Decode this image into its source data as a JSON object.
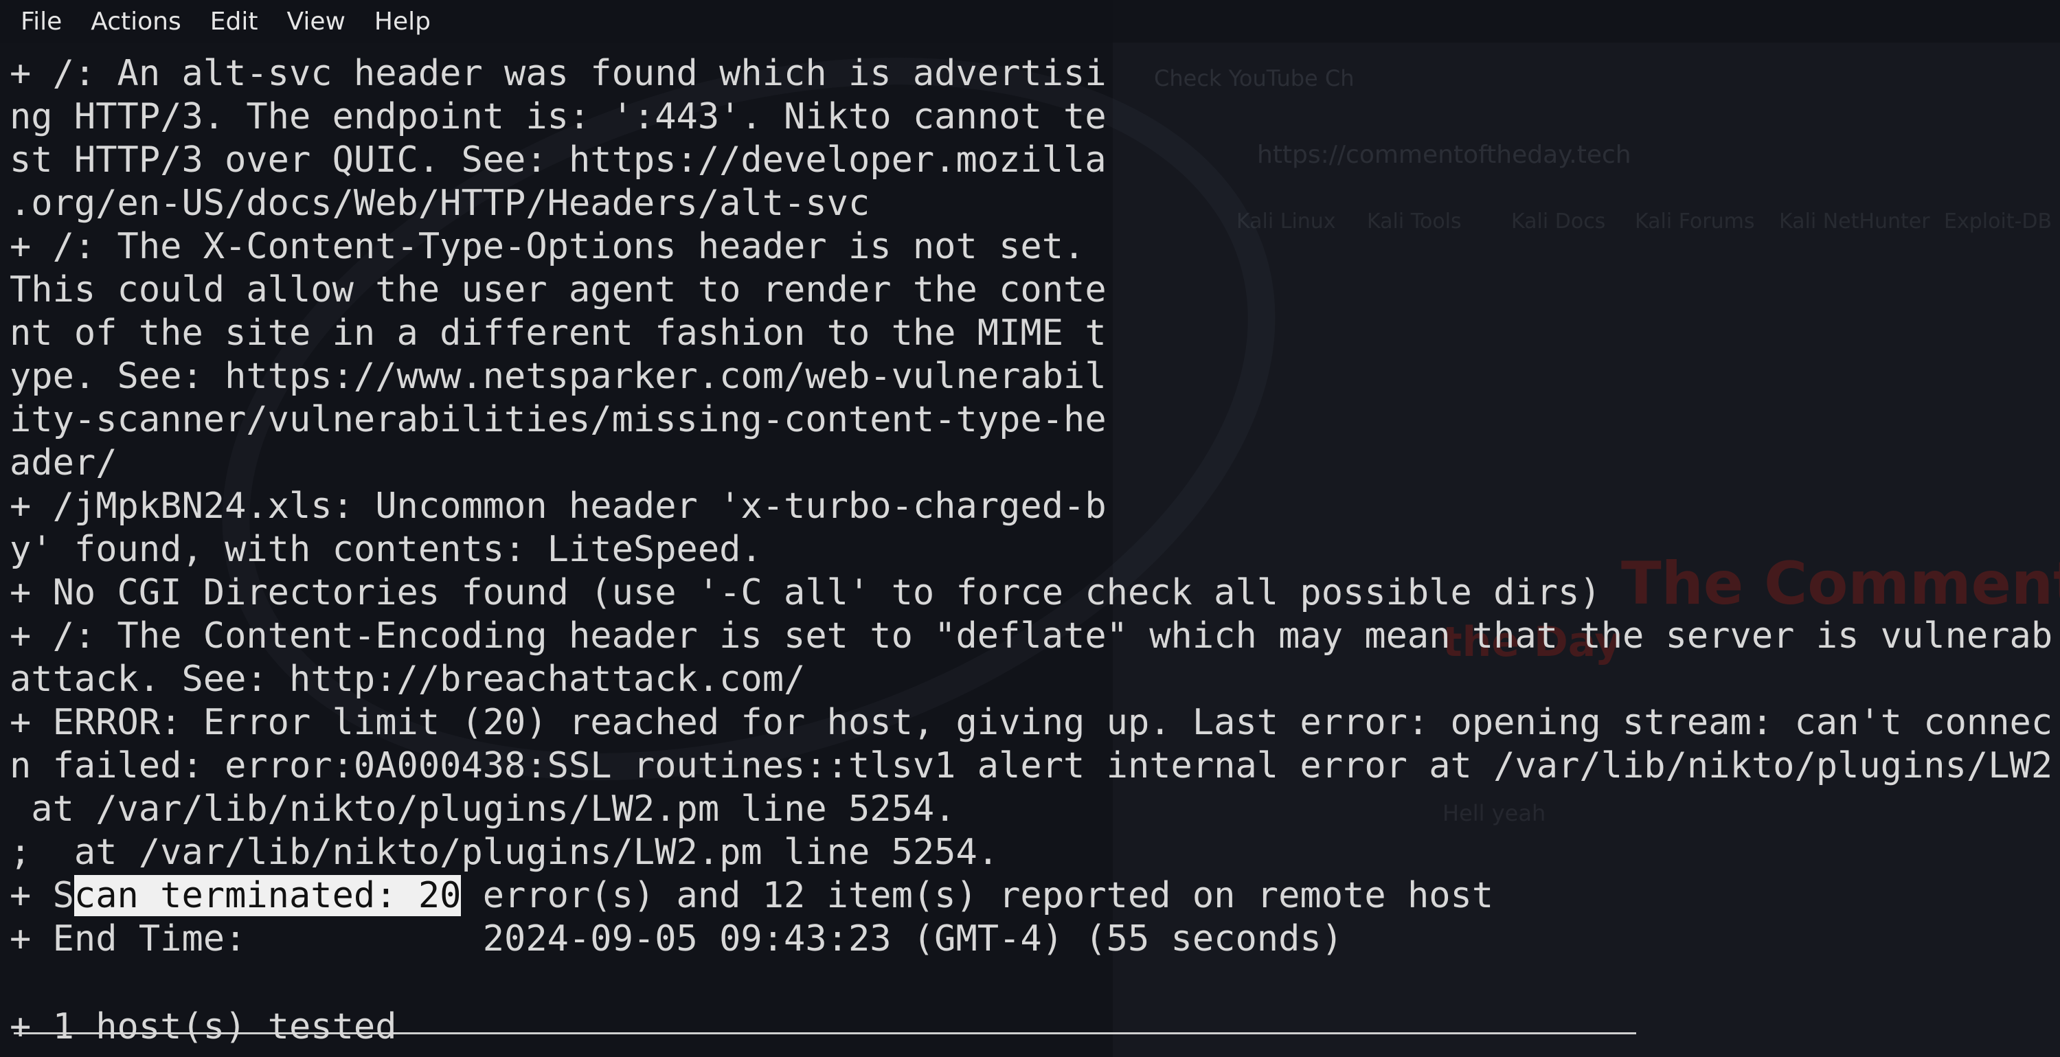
{
  "menu": {
    "items": [
      "File",
      "Actions",
      "Edit",
      "View",
      "Help"
    ]
  },
  "background_browser": {
    "tab_title": "Check YouTube Ch",
    "url": "https://commentoftheday.tech",
    "bookmarks": [
      "Kali Linux",
      "Kali Tools",
      "Kali Docs",
      "Kali Forums",
      "Kali NetHunter",
      "Exploit-DB"
    ],
    "headline": "The Comment of",
    "subheadline": "the Day",
    "caption": "Hell yeah"
  },
  "terminal": {
    "lines": [
      "+ /: An alt-svc header was found which is advertisi",
      "ng HTTP/3. The endpoint is: ':443'. Nikto cannot te",
      "st HTTP/3 over QUIC. See: https://developer.mozilla",
      ".org/en-US/docs/Web/HTTP/Headers/alt-svc",
      "+ /: The X-Content-Type-Options header is not set.",
      "This could allow the user agent to render the conte",
      "nt of the site in a different fashion to the MIME t",
      "ype. See: https://www.netsparker.com/web-vulnerabil",
      "ity-scanner/vulnerabilities/missing-content-type-he",
      "ader/",
      "+ /jMpkBN24.xls: Uncommon header 'x-turbo-charged-b",
      "y' found, with contents: LiteSpeed.",
      "+ No CGI Directories found (use '-C all' to force check all possible dirs)",
      "+ /: The Content-Encoding header is set to \"deflate\" which may mean that the server is vulnerab",
      "attack. See: http://breachattack.com/",
      "+ ERROR: Error limit (20) reached for host, giving up. Last error: opening stream: can't connec",
      "n failed: error:0A000438:SSL routines::tlsv1 alert internal error at /var/lib/nikto/plugins/LW2",
      " at /var/lib/nikto/plugins/LW2.pm line 5254.",
      ";  at /var/lib/nikto/plugins/LW2.pm line 5254."
    ],
    "scan_line": {
      "prefix": "+ S",
      "highlighted": "can terminated: 20",
      "suffix": " error(s) and 12 item(s) reported on remote host"
    },
    "end_time_line": "+ End Time:           2024-09-05 09:43:23 (GMT-4) (55 seconds)",
    "final_line": "+ 1 host(s) tested"
  }
}
